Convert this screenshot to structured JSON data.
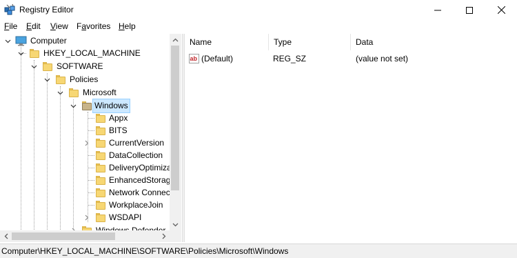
{
  "window": {
    "title": "Registry Editor",
    "controls": {
      "minimize": "minimize",
      "maximize": "maximize",
      "close": "close"
    }
  },
  "menu": [
    {
      "key": "F",
      "rest": "ile"
    },
    {
      "key": "E",
      "rest": "dit"
    },
    {
      "key": "V",
      "rest": "iew"
    },
    {
      "key": "F",
      "rest": "avorites",
      "pre": ""
    },
    {
      "key": "H",
      "rest": "elp"
    }
  ],
  "menu_favorites": {
    "pre": "F",
    "u": "a",
    "post": "vorites"
  },
  "tree": {
    "computer": "Computer",
    "hklm": "HKEY_LOCAL_MACHINE",
    "software": "SOFTWARE",
    "policies": "Policies",
    "microsoft": "Microsoft",
    "windows": "Windows",
    "children": [
      "Appx",
      "BITS",
      "CurrentVersion",
      "DataCollection",
      "DeliveryOptimiza",
      "EnhancedStorag",
      "Network Connec",
      "WorkplaceJoin",
      "WSDAPI"
    ],
    "next_sibling": "Windows Defender"
  },
  "list": {
    "headers": {
      "name": "Name",
      "type": "Type",
      "data": "Data"
    },
    "rows": [
      {
        "name": "(Default)",
        "type": "REG_SZ",
        "data": "(value not set)"
      }
    ]
  },
  "status": {
    "path": "Computer\\HKEY_LOCAL_MACHINE\\SOFTWARE\\Policies\\Microsoft\\Windows"
  },
  "colors": {
    "selection": "#cce8ff",
    "folder": "#f7d774",
    "statusbar": "#f0f0f0"
  }
}
